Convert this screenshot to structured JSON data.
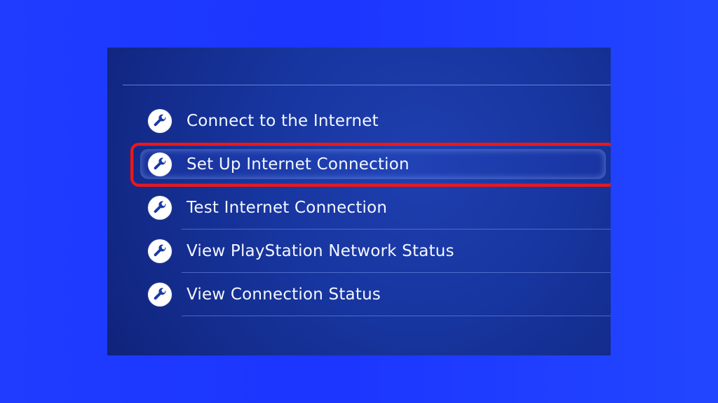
{
  "menu": {
    "items": [
      {
        "label": "Connect to the Internet",
        "icon": "wrench-icon"
      },
      {
        "label": "Set Up Internet Connection",
        "icon": "wrench-icon",
        "selected": true
      },
      {
        "label": "Test Internet Connection",
        "icon": "wrench-icon"
      },
      {
        "label": "View PlayStation Network Status",
        "icon": "wrench-icon"
      },
      {
        "label": "View Connection Status",
        "icon": "wrench-icon"
      }
    ]
  },
  "colors": {
    "background": "#1f3cff",
    "panel": "#17359e",
    "highlight": "#ee1717",
    "text": "#f4f7ff"
  }
}
